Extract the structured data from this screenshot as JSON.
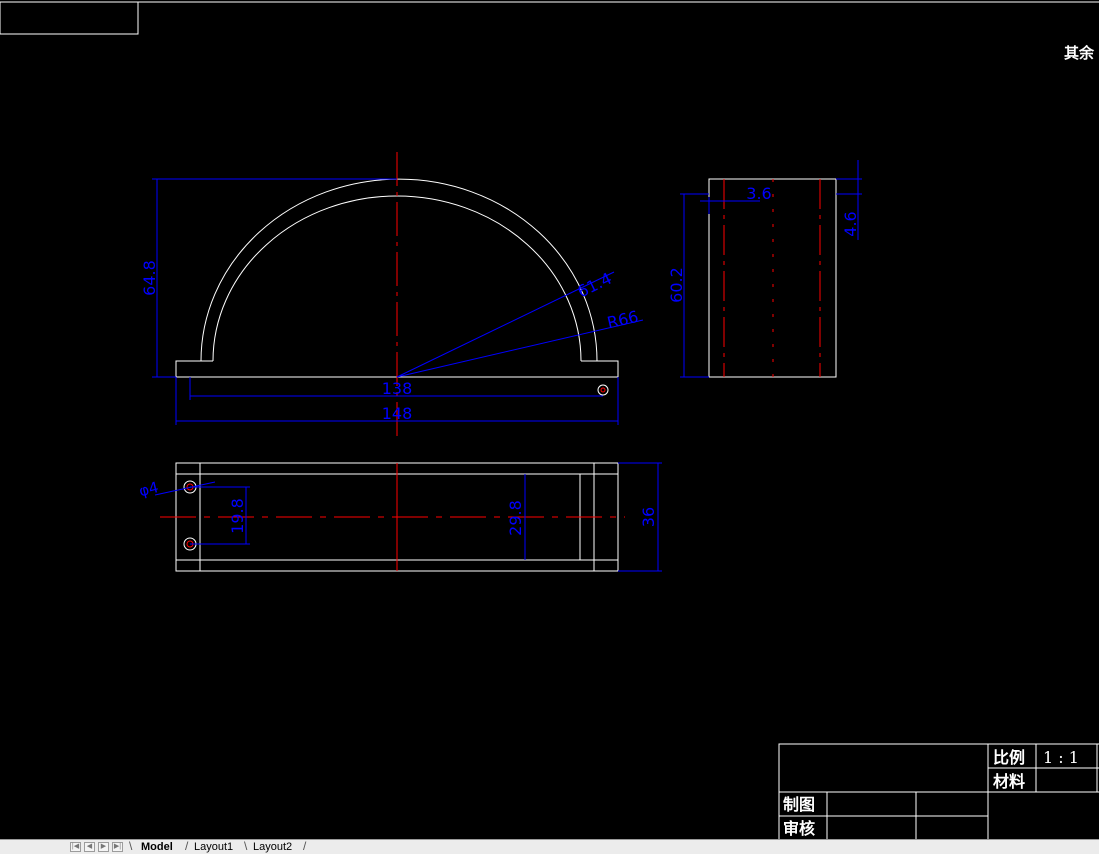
{
  "header": {
    "other_text": "其余"
  },
  "dimensions": {
    "front_height": "64.8",
    "front_r1": "61.4",
    "front_r2": "R66",
    "front_w1": "138",
    "front_w2": "148",
    "side_w": "3.6",
    "side_h": "60.2",
    "side_top": "4.6",
    "bottom_dia": "φ4",
    "bottom_hole_spacing": "19.8",
    "bottom_inner": "29.8",
    "bottom_width": "36"
  },
  "title_block": {
    "scale_label": "比例",
    "scale_value": "1 : 1",
    "material_label": "材料",
    "drawn_label": "制图",
    "checked_label": "审核"
  },
  "tabs": [
    "Model",
    "Layout1",
    "Layout2"
  ],
  "colors": {
    "background": "#000000",
    "geometry": "#ffffff",
    "dimension": "#0000ff",
    "centerline": "#ff0000"
  }
}
